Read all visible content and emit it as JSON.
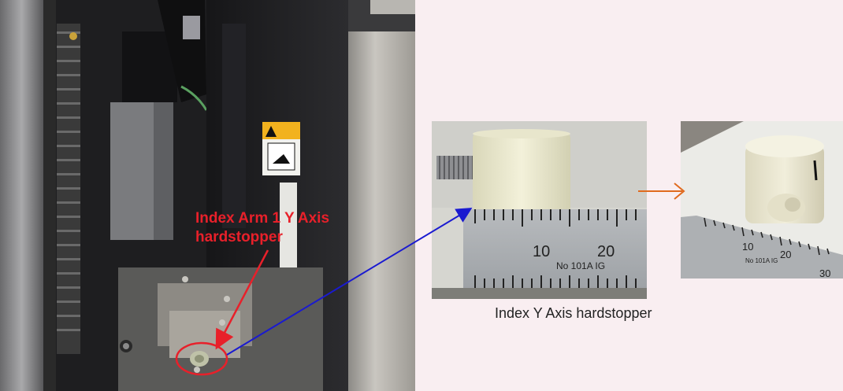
{
  "photos": {
    "machine": {
      "label_line1": "Index Arm 1 Y Axis",
      "label_line2": "hardstopper"
    },
    "closeup": {
      "ruler_text": "No 101A  IG",
      "tick_10": "10",
      "tick_20": "20"
    },
    "angled": {
      "tick_10": "10",
      "tick_20": "20",
      "tick_30": "30",
      "ruler_text": "No 101A IG"
    }
  },
  "caption": "Index Y Axis hardstopper",
  "colors": {
    "label": "#e8202a",
    "link_arrow": "#1a1ad0",
    "next_arrow": "#e06a1e",
    "background": "#f9eef1"
  }
}
